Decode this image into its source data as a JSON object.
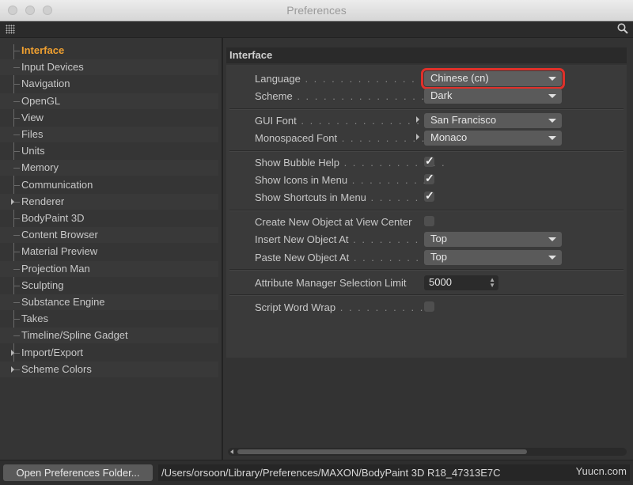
{
  "window": {
    "title": "Preferences"
  },
  "sidebar": {
    "items": [
      {
        "label": "Interface",
        "active": true,
        "expandable": false
      },
      {
        "label": "Input Devices",
        "expandable": false
      },
      {
        "label": "Navigation",
        "expandable": false
      },
      {
        "label": "OpenGL",
        "expandable": false
      },
      {
        "label": "View",
        "expandable": false
      },
      {
        "label": "Files",
        "expandable": false
      },
      {
        "label": "Units",
        "expandable": false
      },
      {
        "label": "Memory",
        "expandable": false
      },
      {
        "label": "Communication",
        "expandable": false
      },
      {
        "label": "Renderer",
        "expandable": true
      },
      {
        "label": "BodyPaint 3D",
        "expandable": false
      },
      {
        "label": "Content Browser",
        "expandable": false
      },
      {
        "label": "Material Preview",
        "expandable": false
      },
      {
        "label": "Projection Man",
        "expandable": false
      },
      {
        "label": "Sculpting",
        "expandable": false
      },
      {
        "label": "Substance Engine",
        "expandable": false
      },
      {
        "label": "Takes",
        "expandable": false
      },
      {
        "label": "Timeline/Spline Gadget",
        "expandable": false
      },
      {
        "label": "Import/Export",
        "expandable": true
      },
      {
        "label": "Scheme Colors",
        "expandable": true
      }
    ]
  },
  "main": {
    "header": "Interface",
    "language": {
      "label": "Language",
      "value": "Chinese (cn)"
    },
    "scheme": {
      "label": "Scheme",
      "value": "Dark"
    },
    "gui_font": {
      "label": "GUI Font",
      "value": "San Francisco"
    },
    "mono_font": {
      "label": "Monospaced Font",
      "value": "Monaco"
    },
    "bubble_help": {
      "label": "Show Bubble Help",
      "checked": true
    },
    "icons_menu": {
      "label": "Show Icons in Menu",
      "checked": true
    },
    "shortcuts_menu": {
      "label": "Show Shortcuts in Menu",
      "checked": true
    },
    "view_center": {
      "label": "Create New Object at View Center",
      "checked": false
    },
    "insert_at": {
      "label": "Insert New Object At",
      "value": "Top"
    },
    "paste_at": {
      "label": "Paste New Object At",
      "value": "Top"
    },
    "attr_limit": {
      "label": "Attribute Manager Selection Limit",
      "value": "5000"
    },
    "word_wrap": {
      "label": "Script Word Wrap",
      "checked": false
    }
  },
  "footer": {
    "button_label": "Open Preferences Folder...",
    "path": "/Users/orsoon/Library/Preferences/MAXON/BodyPaint 3D R18_47313E7C",
    "watermark": "Yuucn.com"
  },
  "icons": {
    "search": "search-icon",
    "grip": "grip-icon"
  },
  "colors": {
    "active": "#f0a030",
    "highlight_outline": "#e0302a"
  }
}
